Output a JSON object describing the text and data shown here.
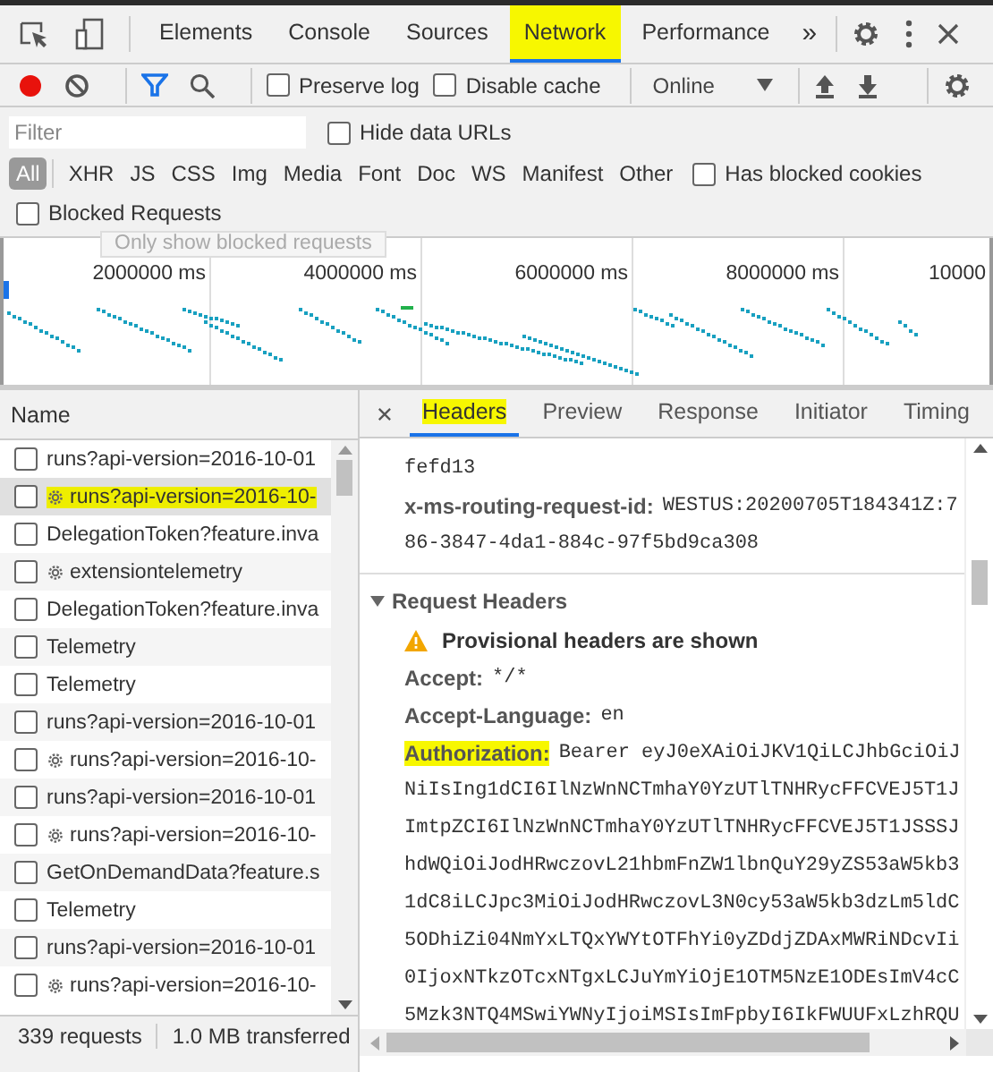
{
  "main_tabs": [
    {
      "label": "Elements",
      "selected": false,
      "highlighted": false
    },
    {
      "label": "Console",
      "selected": false,
      "highlighted": false
    },
    {
      "label": "Sources",
      "selected": false,
      "highlighted": false
    },
    {
      "label": "Network",
      "selected": true,
      "highlighted": true
    },
    {
      "label": "Performance",
      "selected": false,
      "highlighted": false
    }
  ],
  "more_tabs": "»",
  "toolbar": {
    "recording": true,
    "filter_active": true,
    "preserve_log": {
      "label": "Preserve log",
      "checked": false
    },
    "disable_cache": {
      "label": "Disable cache",
      "checked": false
    },
    "throttling": "Online"
  },
  "filter": {
    "placeholder": "Filter",
    "hide_data_urls": {
      "label": "Hide data URLs",
      "checked": false
    }
  },
  "type_filters": [
    {
      "label": "All",
      "selected": true
    },
    {
      "label": "XHR",
      "selected": false
    },
    {
      "label": "JS",
      "selected": false
    },
    {
      "label": "CSS",
      "selected": false
    },
    {
      "label": "Img",
      "selected": false
    },
    {
      "label": "Media",
      "selected": false
    },
    {
      "label": "Font",
      "selected": false
    },
    {
      "label": "Doc",
      "selected": false
    },
    {
      "label": "WS",
      "selected": false
    },
    {
      "label": "Manifest",
      "selected": false
    },
    {
      "label": "Other",
      "selected": false
    }
  ],
  "has_blocked_cookies": {
    "label": "Has blocked cookies",
    "checked": false
  },
  "blocked_requests": {
    "label": "Blocked Requests",
    "checked": false
  },
  "tooltip": "Only show blocked requests",
  "overview_ticks": [
    "2000000 ms",
    "4000000 ms",
    "6000000 ms",
    "8000000 ms",
    "10000"
  ],
  "requests": {
    "column": "Name",
    "rows": [
      {
        "name": "runs?api-version=2016-10-01",
        "kind": "plain",
        "selected": false,
        "highlighted": false
      },
      {
        "name": "runs?api-version=2016-10-",
        "kind": "service-worker",
        "selected": true,
        "highlighted": true
      },
      {
        "name": "DelegationToken?feature.inva",
        "kind": "plain",
        "selected": false,
        "highlighted": false
      },
      {
        "name": "extensiontelemetry",
        "kind": "service-worker",
        "selected": false,
        "highlighted": false
      },
      {
        "name": "DelegationToken?feature.inva",
        "kind": "plain",
        "selected": false,
        "highlighted": false
      },
      {
        "name": "Telemetry",
        "kind": "plain",
        "selected": false,
        "highlighted": false
      },
      {
        "name": "Telemetry",
        "kind": "plain",
        "selected": false,
        "highlighted": false
      },
      {
        "name": "runs?api-version=2016-10-01",
        "kind": "plain",
        "selected": false,
        "highlighted": false
      },
      {
        "name": "runs?api-version=2016-10-",
        "kind": "service-worker",
        "selected": false,
        "highlighted": false
      },
      {
        "name": "runs?api-version=2016-10-01",
        "kind": "plain",
        "selected": false,
        "highlighted": false
      },
      {
        "name": "runs?api-version=2016-10-",
        "kind": "service-worker",
        "selected": false,
        "highlighted": false
      },
      {
        "name": "GetOnDemandData?feature.s",
        "kind": "plain",
        "selected": false,
        "highlighted": false
      },
      {
        "name": "Telemetry",
        "kind": "plain",
        "selected": false,
        "highlighted": false
      },
      {
        "name": "runs?api-version=2016-10-01",
        "kind": "plain",
        "selected": false,
        "highlighted": false
      },
      {
        "name": "runs?api-version=2016-10-",
        "kind": "service-worker",
        "selected": false,
        "highlighted": false
      }
    ]
  },
  "status_bar": {
    "requests": "339 requests",
    "transferred": "1.0 MB transferred"
  },
  "detail_tabs": [
    {
      "label": "Headers",
      "selected": true,
      "highlighted": true
    },
    {
      "label": "Preview",
      "selected": false,
      "highlighted": false
    },
    {
      "label": "Response",
      "selected": false,
      "highlighted": false
    },
    {
      "label": "Initiator",
      "selected": false,
      "highlighted": false
    },
    {
      "label": "Timing",
      "selected": false,
      "highlighted": false
    }
  ],
  "response_lines": [
    {
      "kind": "continuation",
      "text": "fefd13"
    },
    {
      "kind": "header",
      "name": "x-ms-routing-request-id:",
      "value": "WESTUS:20200705T184341Z:7",
      "highlighted": false
    },
    {
      "kind": "continuation",
      "text": "86-3847-4da1-884c-97f5bd9ca308"
    }
  ],
  "request_headers": {
    "title": "Request Headers",
    "expanded": true,
    "warning": "Provisional headers are shown",
    "lines": [
      {
        "kind": "header",
        "name": "Accept:",
        "value": "*/*",
        "highlighted": false
      },
      {
        "kind": "header",
        "name": "Accept-Language:",
        "value": "en",
        "highlighted": false
      },
      {
        "kind": "header",
        "name": "Authorization:",
        "value": "Bearer eyJ0eXAiOiJKV1QiLCJhbGciOiJ",
        "highlighted": true
      },
      {
        "kind": "continuation",
        "text": "NiIsIng1dCI6IlNzWnNCTmhaY0YzUTlTNHRycFFCVEJ5T1J"
      },
      {
        "kind": "continuation",
        "text": "ImtpZCI6IlNzWnNCTmhaY0YzUTlTNHRycFFCVEJ5T1JSSSJ"
      },
      {
        "kind": "continuation",
        "text": "hdWQiOiJodHRwczovL21hbmFnZW1lbnQuY29yZS53aW5kb3"
      },
      {
        "kind": "continuation",
        "text": "1dC8iLCJpc3MiOiJodHRwczovL3N0cy53aW5kb3dzLm5ldC"
      },
      {
        "kind": "continuation",
        "text": "5ODhiZi04NmYxLTQxYWYtOTFhYi0yZDdjZDAxMWRiNDcvIi"
      },
      {
        "kind": "continuation",
        "text": "0IjoxNTkzOTcxNTgxLCJuYmYiOjE1OTM5NzE1ODEsImV4cC"
      },
      {
        "kind": "continuation",
        "text": "5Mzk3NTQ4MSwiYWNyIjoiMSIsImFpbyI6IkFWUUFxLzhRQU"
      }
    ]
  }
}
